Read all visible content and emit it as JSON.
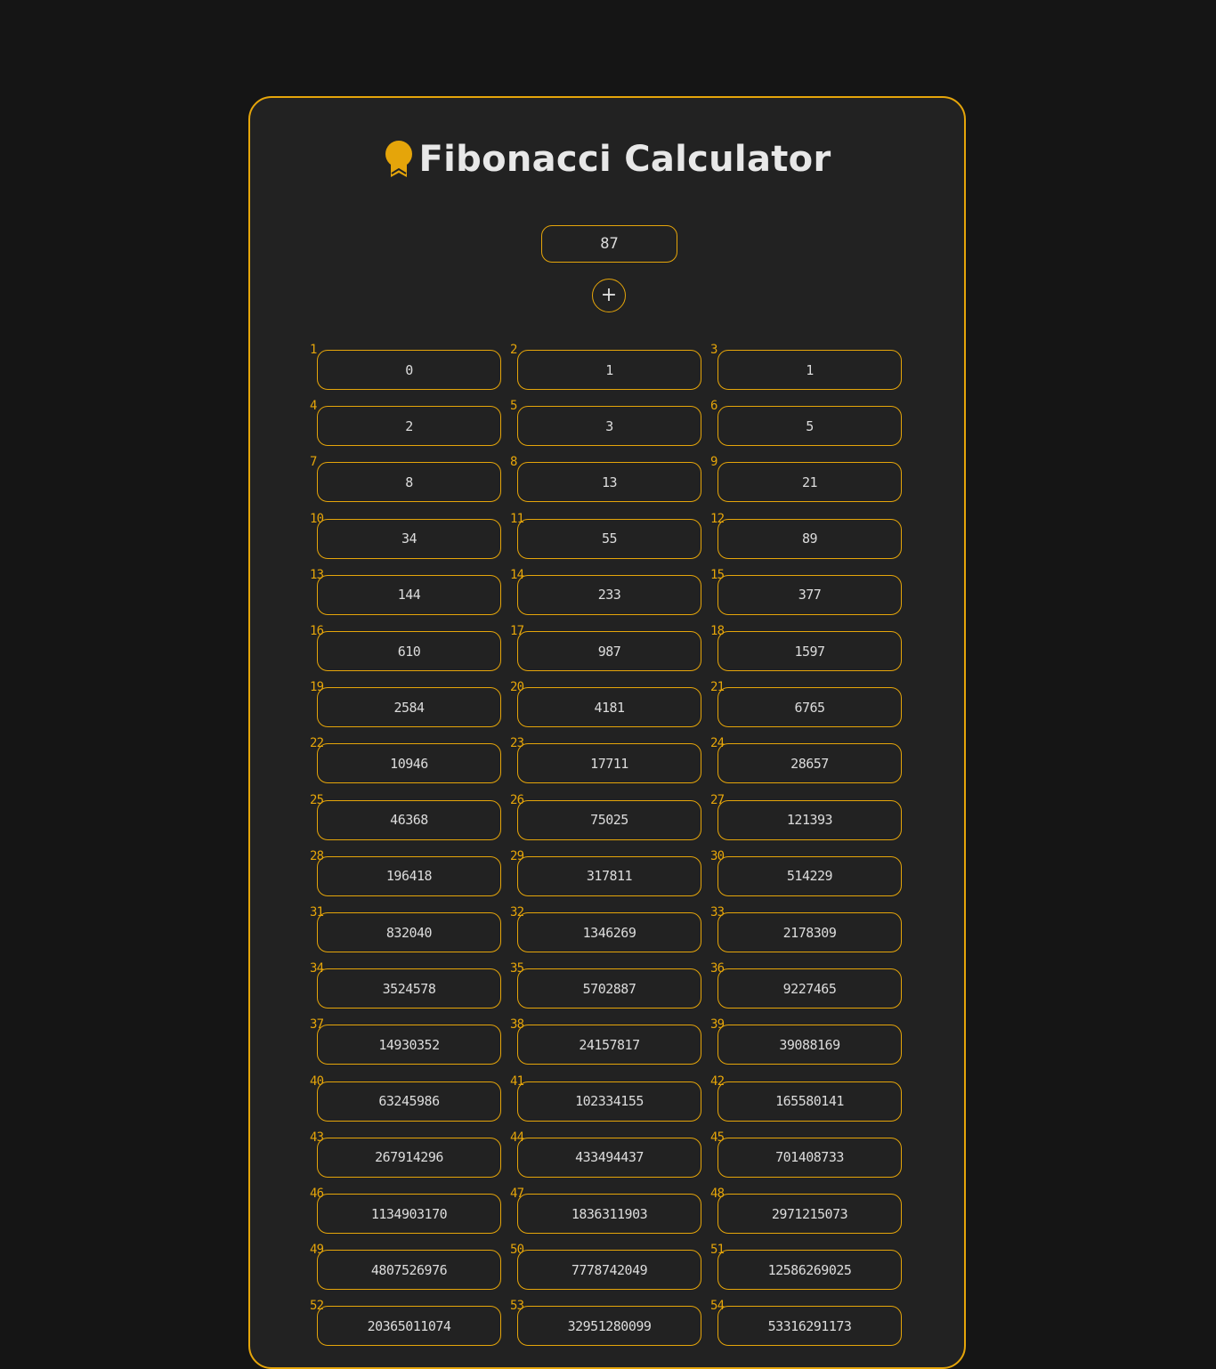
{
  "app": {
    "title": "Fibonacci Calculator",
    "icon": "award-icon",
    "accent_color": "#e5a50a"
  },
  "controls": {
    "count_value": "87",
    "add_button_label": "+"
  },
  "results": [
    {
      "index": "1",
      "value": "0"
    },
    {
      "index": "2",
      "value": "1"
    },
    {
      "index": "3",
      "value": "1"
    },
    {
      "index": "4",
      "value": "2"
    },
    {
      "index": "5",
      "value": "3"
    },
    {
      "index": "6",
      "value": "5"
    },
    {
      "index": "7",
      "value": "8"
    },
    {
      "index": "8",
      "value": "13"
    },
    {
      "index": "9",
      "value": "21"
    },
    {
      "index": "10",
      "value": "34"
    },
    {
      "index": "11",
      "value": "55"
    },
    {
      "index": "12",
      "value": "89"
    },
    {
      "index": "13",
      "value": "144"
    },
    {
      "index": "14",
      "value": "233"
    },
    {
      "index": "15",
      "value": "377"
    },
    {
      "index": "16",
      "value": "610"
    },
    {
      "index": "17",
      "value": "987"
    },
    {
      "index": "18",
      "value": "1597"
    },
    {
      "index": "19",
      "value": "2584"
    },
    {
      "index": "20",
      "value": "4181"
    },
    {
      "index": "21",
      "value": "6765"
    },
    {
      "index": "22",
      "value": "10946"
    },
    {
      "index": "23",
      "value": "17711"
    },
    {
      "index": "24",
      "value": "28657"
    },
    {
      "index": "25",
      "value": "46368"
    },
    {
      "index": "26",
      "value": "75025"
    },
    {
      "index": "27",
      "value": "121393"
    },
    {
      "index": "28",
      "value": "196418"
    },
    {
      "index": "29",
      "value": "317811"
    },
    {
      "index": "30",
      "value": "514229"
    },
    {
      "index": "31",
      "value": "832040"
    },
    {
      "index": "32",
      "value": "1346269"
    },
    {
      "index": "33",
      "value": "2178309"
    },
    {
      "index": "34",
      "value": "3524578"
    },
    {
      "index": "35",
      "value": "5702887"
    },
    {
      "index": "36",
      "value": "9227465"
    },
    {
      "index": "37",
      "value": "14930352"
    },
    {
      "index": "38",
      "value": "24157817"
    },
    {
      "index": "39",
      "value": "39088169"
    },
    {
      "index": "40",
      "value": "63245986"
    },
    {
      "index": "41",
      "value": "102334155"
    },
    {
      "index": "42",
      "value": "165580141"
    },
    {
      "index": "43",
      "value": "267914296"
    },
    {
      "index": "44",
      "value": "433494437"
    },
    {
      "index": "45",
      "value": "701408733"
    },
    {
      "index": "46",
      "value": "1134903170"
    },
    {
      "index": "47",
      "value": "1836311903"
    },
    {
      "index": "48",
      "value": "2971215073"
    },
    {
      "index": "49",
      "value": "4807526976"
    },
    {
      "index": "50",
      "value": "7778742049"
    },
    {
      "index": "51",
      "value": "12586269025"
    },
    {
      "index": "52",
      "value": "20365011074"
    },
    {
      "index": "53",
      "value": "32951280099"
    },
    {
      "index": "54",
      "value": "53316291173"
    }
  ]
}
